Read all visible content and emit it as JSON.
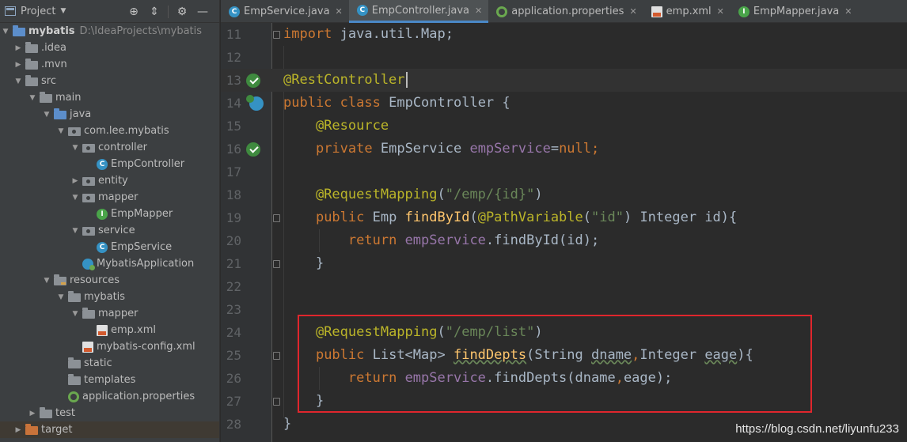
{
  "project_panel": {
    "title": "Project",
    "tree": [
      {
        "label": "mybatis",
        "path": "D:\\IdeaProjects\\mybatis",
        "icon": "folder-blue",
        "expanded": true
      },
      {
        "label": ".idea",
        "icon": "folder"
      },
      {
        "label": ".mvn",
        "icon": "folder"
      },
      {
        "label": "src",
        "icon": "folder"
      },
      {
        "label": "main",
        "icon": "folder"
      },
      {
        "label": "java",
        "icon": "folder-blue"
      },
      {
        "label": "com.lee.mybatis",
        "icon": "package"
      },
      {
        "label": "controller",
        "icon": "package"
      },
      {
        "label": "EmpController",
        "icon": "class"
      },
      {
        "label": "entity",
        "icon": "package"
      },
      {
        "label": "mapper",
        "icon": "package"
      },
      {
        "label": "EmpMapper",
        "icon": "interface"
      },
      {
        "label": "service",
        "icon": "package"
      },
      {
        "label": "EmpService",
        "icon": "class"
      },
      {
        "label": "MybatisApplication",
        "icon": "spring-class"
      },
      {
        "label": "resources",
        "icon": "folder-resources"
      },
      {
        "label": "mybatis",
        "icon": "folder"
      },
      {
        "label": "mapper",
        "icon": "folder"
      },
      {
        "label": "emp.xml",
        "icon": "xml"
      },
      {
        "label": "mybatis-config.xml",
        "icon": "xml"
      },
      {
        "label": "static",
        "icon": "folder"
      },
      {
        "label": "templates",
        "icon": "folder"
      },
      {
        "label": "application.properties",
        "icon": "properties"
      },
      {
        "label": "test",
        "icon": "folder"
      },
      {
        "label": "target",
        "icon": "folder-orange"
      }
    ]
  },
  "tabs": [
    {
      "label": "EmpService.java",
      "icon": "class"
    },
    {
      "label": "EmpController.java",
      "icon": "class",
      "active": true
    },
    {
      "label": "application.properties",
      "icon": "properties"
    },
    {
      "label": "emp.xml",
      "icon": "xml"
    },
    {
      "label": "EmpMapper.java",
      "icon": "interface"
    }
  ],
  "editor": {
    "line_numbers": [
      "11",
      "12",
      "13",
      "14",
      "15",
      "16",
      "17",
      "18",
      "19",
      "20",
      "21",
      "22",
      "23",
      "24",
      "25",
      "26",
      "27",
      "28"
    ],
    "colors": {
      "keyword": "#cc7832",
      "annotation": "#bbb529",
      "string": "#6a8759",
      "field": "#9876aa",
      "method": "#ffc66d",
      "text": "#a9b7c6",
      "highlight_box": "#e0262d"
    }
  },
  "code": {
    "l11_import": "import",
    "l11_rest": " java.util.Map;",
    "l13_ann": "@RestController",
    "l14_public": "public",
    "l14_class": "class",
    "l14_name": "EmpController {",
    "l15_ann": "@Resource",
    "l16_private": "private",
    "l16_type": "EmpService ",
    "l16_field": "empService",
    "l16_eq": "=",
    "l16_null": "null;",
    "l18_ann": "@RequestMapping",
    "l18_open": "(",
    "l18_str": "\"/emp/{id}\"",
    "l18_close": ")",
    "l19_public": "public",
    "l19_type": " Emp ",
    "l19_fn": "findById",
    "l19_p1": "(",
    "l19_ann": "@PathVariable",
    "l19_p2": "(",
    "l19_str": "\"id\"",
    "l19_rest": ") Integer id){",
    "l20_return": "return",
    "l20_field": "empService",
    "l20_rest": ".findById(id);",
    "l21_brace": "}",
    "l24_ann": "@RequestMapping",
    "l24_open": "(",
    "l24_str": "\"/emp/list\"",
    "l24_close": ")",
    "l25_public": "public",
    "l25_type": " List<Map> ",
    "l25_fn": "findDepts",
    "l25_p1": "(String ",
    "l25_dname": "dname",
    "l25_comma": ",",
    "l25_p2": "Integer ",
    "l25_eage": "eage",
    "l25_p3": "){",
    "l26_return": "return",
    "l26_field": "empService",
    "l26_p1": ".findDepts(dname",
    "l26_comma": ",",
    "l26_p2": "eage);",
    "l27_brace": "}",
    "l28_brace": "}"
  },
  "watermark": "https://blog.csdn.net/liyunfu233"
}
